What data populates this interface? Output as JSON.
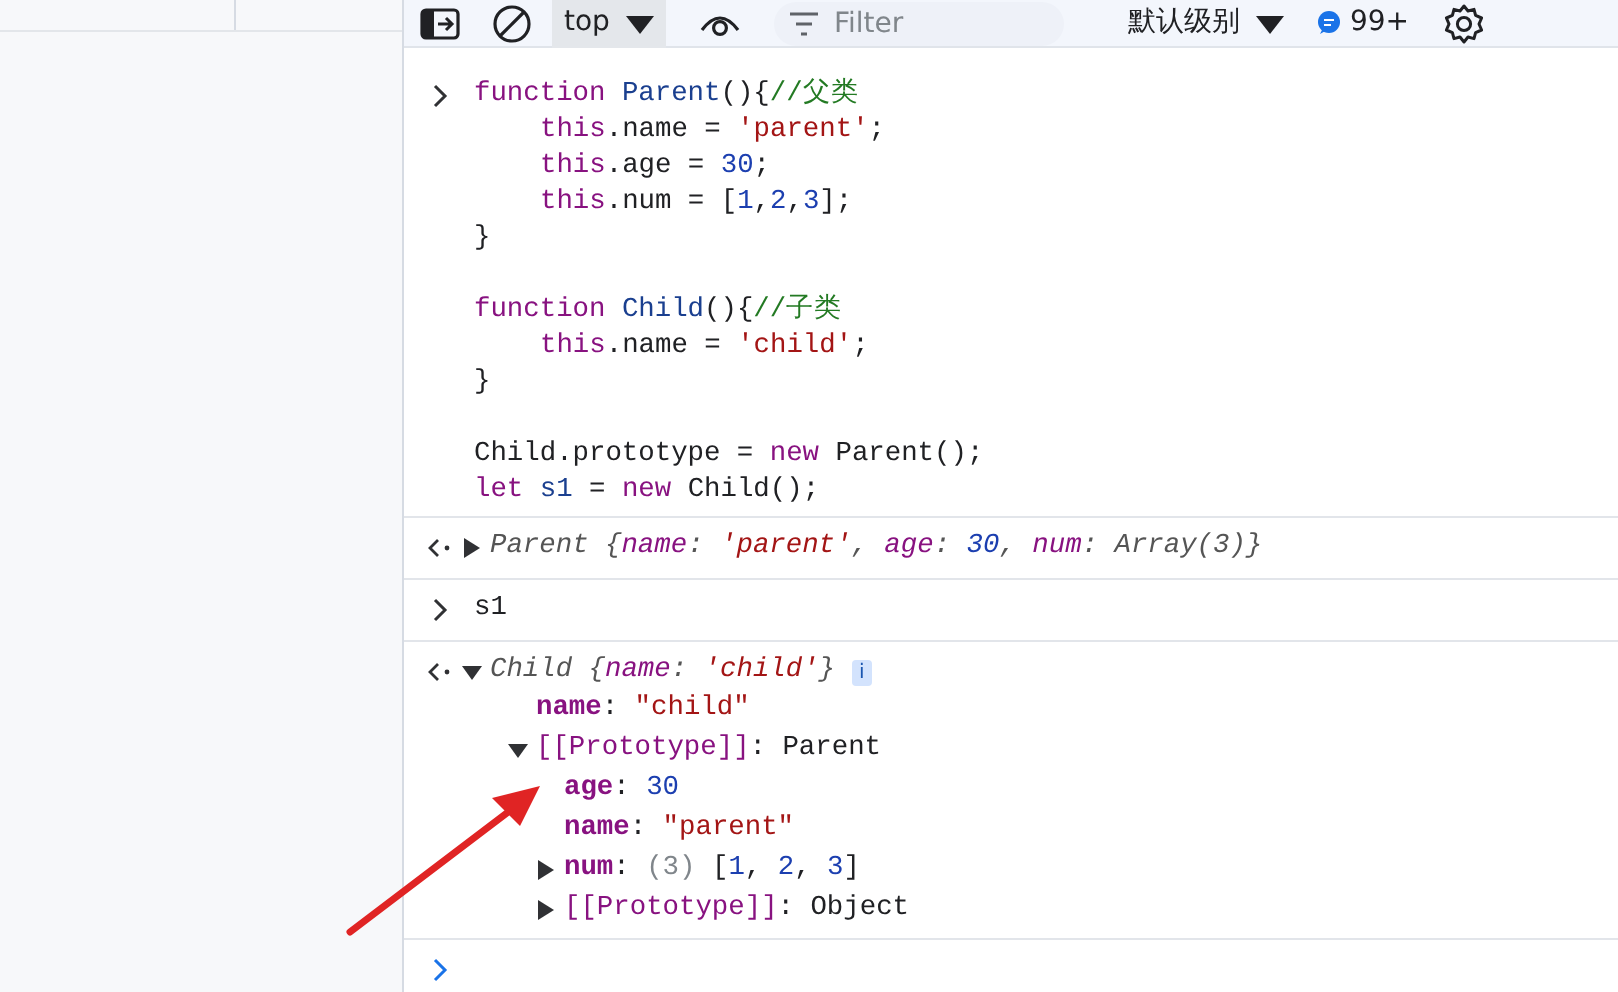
{
  "toolbar": {
    "context": "top",
    "filter_placeholder": "Filter",
    "log_level": "默认级别",
    "issues_count": "99+"
  },
  "entries": [
    {
      "kind": "input",
      "code_blocks": [
        [
          {
            "indented": false,
            "tokens": [
              {
                "kind": "keyword",
                "text": "function "
              },
              {
                "kind": "name",
                "text": "Parent"
              },
              {
                "kind": "plain",
                "text": "(){"
              },
              {
                "kind": "comment",
                "text": "//父类"
              }
            ]
          },
          {
            "indented": true,
            "tokens": [
              {
                "kind": "keyword",
                "text": "this"
              },
              {
                "kind": "plain",
                "text": ".name = "
              },
              {
                "kind": "string",
                "text": "'parent'"
              },
              {
                "kind": "plain",
                "text": ";"
              }
            ]
          },
          {
            "indented": true,
            "tokens": [
              {
                "kind": "keyword",
                "text": "this"
              },
              {
                "kind": "plain",
                "text": ".age = "
              },
              {
                "kind": "number",
                "text": "30"
              },
              {
                "kind": "plain",
                "text": ";"
              }
            ]
          },
          {
            "indented": true,
            "tokens": [
              {
                "kind": "keyword",
                "text": "this"
              },
              {
                "kind": "plain",
                "text": ".num = ["
              },
              {
                "kind": "number",
                "text": "1"
              },
              {
                "kind": "plain",
                "text": ","
              },
              {
                "kind": "number",
                "text": "2"
              },
              {
                "kind": "plain",
                "text": ","
              },
              {
                "kind": "number",
                "text": "3"
              },
              {
                "kind": "plain",
                "text": "];"
              }
            ]
          },
          {
            "indented": false,
            "tokens": [
              {
                "kind": "plain",
                "text": "}"
              }
            ]
          }
        ],
        [
          {
            "indented": false,
            "tokens": [
              {
                "kind": "keyword",
                "text": "function "
              },
              {
                "kind": "name",
                "text": "Child"
              },
              {
                "kind": "plain",
                "text": "(){"
              },
              {
                "kind": "comment",
                "text": "//子类"
              }
            ]
          },
          {
            "indented": true,
            "tokens": [
              {
                "kind": "keyword",
                "text": "this"
              },
              {
                "kind": "plain",
                "text": ".name = "
              },
              {
                "kind": "string",
                "text": "'child'"
              },
              {
                "kind": "plain",
                "text": ";"
              }
            ]
          },
          {
            "indented": false,
            "tokens": [
              {
                "kind": "plain",
                "text": "}"
              }
            ]
          }
        ],
        [
          {
            "indented": false,
            "tokens": [
              {
                "kind": "plain",
                "text": "Child.prototype = "
              },
              {
                "kind": "keyword",
                "text": "new"
              },
              {
                "kind": "plain",
                "text": " Parent();"
              }
            ]
          },
          {
            "indented": false,
            "tokens": [
              {
                "kind": "keyword",
                "text": "let "
              },
              {
                "kind": "name",
                "text": "s1"
              },
              {
                "kind": "plain",
                "text": " = "
              },
              {
                "kind": "keyword",
                "text": "new"
              },
              {
                "kind": "plain",
                "text": " Child();"
              }
            ]
          }
        ]
      ]
    },
    {
      "kind": "result",
      "expanded": false,
      "preview": [
        {
          "kind": "plain",
          "text": "Parent {"
        },
        {
          "kind": "key",
          "text": "name"
        },
        {
          "kind": "plain",
          "text": ": "
        },
        {
          "kind": "string",
          "text": "'parent'"
        },
        {
          "kind": "plain",
          "text": ", "
        },
        {
          "kind": "key",
          "text": "age"
        },
        {
          "kind": "plain",
          "text": ": "
        },
        {
          "kind": "number",
          "text": "30"
        },
        {
          "kind": "plain",
          "text": ", "
        },
        {
          "kind": "key",
          "text": "num"
        },
        {
          "kind": "plain",
          "text": ": Array(3)}"
        }
      ]
    },
    {
      "kind": "input",
      "code_blocks": [
        [
          {
            "indented": false,
            "tokens": [
              {
                "kind": "plain",
                "text": "s1"
              }
            ]
          }
        ]
      ]
    },
    {
      "kind": "result",
      "expanded": true,
      "info_badge": "i",
      "preview": [
        {
          "kind": "plain",
          "text": "Child {"
        },
        {
          "kind": "key",
          "text": "name"
        },
        {
          "kind": "plain",
          "text": ": "
        },
        {
          "kind": "string",
          "text": "'child'"
        },
        {
          "kind": "plain",
          "text": "}"
        }
      ],
      "children": [
        {
          "kind": "property",
          "key": "name",
          "value": [
            {
              "kind": "plain",
              "text": ": "
            },
            {
              "kind": "string",
              "text": "\"child\""
            }
          ]
        },
        {
          "kind": "internal",
          "key": "[[Prototype]]",
          "expanded": true,
          "value": [
            {
              "kind": "plain",
              "text": ": Parent"
            }
          ],
          "children": [
            {
              "kind": "property",
              "key": "age",
              "value": [
                {
                  "kind": "plain",
                  "text": ": "
                },
                {
                  "kind": "number",
                  "text": "30"
                }
              ]
            },
            {
              "kind": "property",
              "key": "name",
              "value": [
                {
                  "kind": "plain",
                  "text": ": "
                },
                {
                  "kind": "string",
                  "text": "\"parent\""
                }
              ]
            },
            {
              "kind": "property",
              "key": "num",
              "expanded": false,
              "value": [
                {
                  "kind": "plain",
                  "text": ": "
                },
                {
                  "kind": "muted",
                  "text": "(3)"
                },
                {
                  "kind": "plain",
                  "text": " ["
                },
                {
                  "kind": "number",
                  "text": "1"
                },
                {
                  "kind": "plain",
                  "text": ", "
                },
                {
                  "kind": "number",
                  "text": "2"
                },
                {
                  "kind": "plain",
                  "text": ", "
                },
                {
                  "kind": "number",
                  "text": "3"
                },
                {
                  "kind": "plain",
                  "text": "]"
                }
              ]
            },
            {
              "kind": "internal",
              "key": "[[Prototype]]",
              "expanded": false,
              "value": [
                {
                  "kind": "plain",
                  "text": ": Object"
                }
              ]
            }
          ]
        }
      ]
    }
  ],
  "annotations": [
    {
      "kind": "arrow"
    }
  ]
}
